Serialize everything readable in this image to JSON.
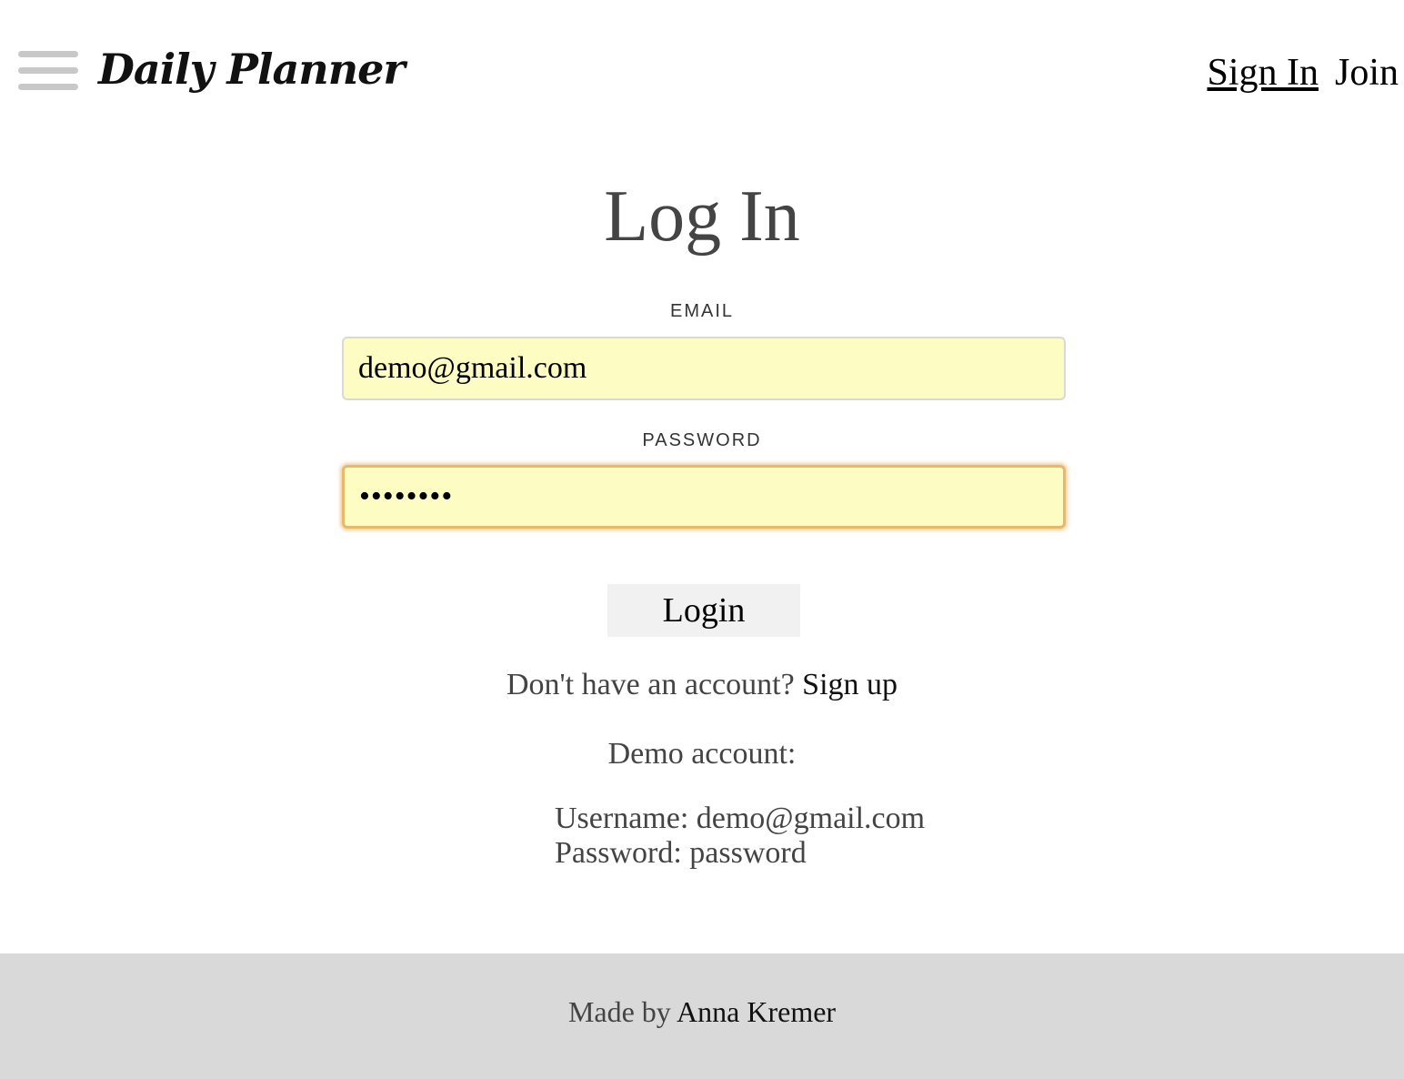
{
  "header": {
    "brand": "Daily Planner",
    "menu_icon": "hamburger-menu-icon",
    "nav": {
      "sign_in": "Sign In",
      "join": "Join"
    }
  },
  "login_form": {
    "title": "Log In",
    "email": {
      "label": "EMAIL",
      "value": "demo@gmail.com"
    },
    "password": {
      "label": "PASSWORD",
      "value": "password"
    },
    "submit_label": "Login",
    "signup_prompt": "Don't have an account?",
    "signup_link": "Sign up"
  },
  "demo": {
    "title": "Demo account:",
    "username_line": "Username: demo@gmail.com",
    "password_line": "Password: password"
  },
  "footer": {
    "made_by": "Made by",
    "author": "Anna Kremer"
  },
  "colors": {
    "input_background": "#fdfcc3",
    "focus_border": "#e8b96a",
    "footer_background": "#d9d9d9",
    "button_background": "#f1f1f1"
  }
}
